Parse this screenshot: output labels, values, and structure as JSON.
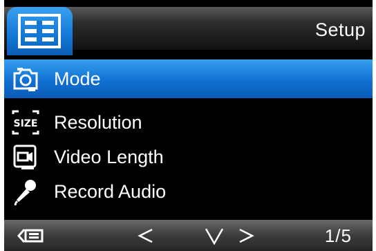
{
  "header": {
    "title": "Setup",
    "tab_icon": "menu-list-icon"
  },
  "menu": {
    "items": [
      {
        "label": "Mode",
        "icon": "camera-mode-icon",
        "selected": true
      },
      {
        "label": "Resolution",
        "icon": "size-icon",
        "icon_text": "SIZE"
      },
      {
        "label": "Video Length",
        "icon": "video-length-icon"
      },
      {
        "label": "Record Audio",
        "icon": "microphone-icon"
      }
    ]
  },
  "footer": {
    "back_icon": "back-menu-icon",
    "prev_icon": "chevron-left-icon",
    "down_icon": "chevron-down-icon",
    "next_icon": "chevron-right-icon",
    "page": "1/5"
  },
  "colors": {
    "accent": "#1277d6",
    "text": "#ffffff",
    "background": "#000000"
  }
}
